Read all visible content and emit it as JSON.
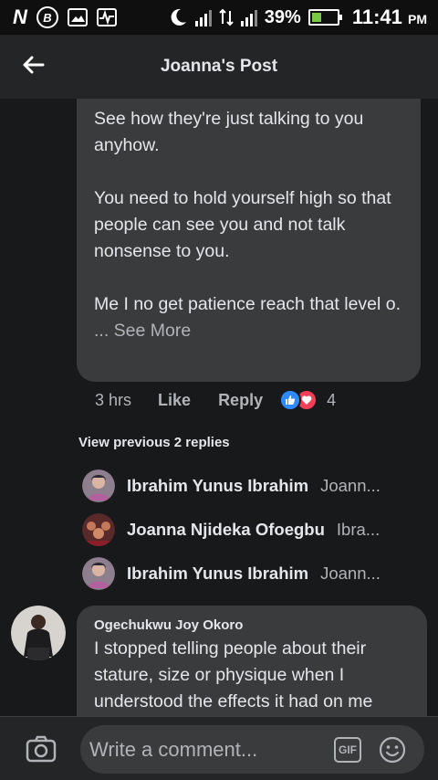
{
  "status_bar": {
    "battery_percent": "39%",
    "battery_level": 0.39,
    "time": "11:41",
    "ampm": "PM",
    "icons": [
      "n-icon",
      "b-icon",
      "gallery-icon",
      "activity-icon",
      "moon-icon",
      "signal-icon",
      "data-arrows-icon",
      "signal-icon",
      "battery-icon"
    ]
  },
  "header": {
    "title": "Joanna's Post",
    "back_icon": "arrow-left-icon"
  },
  "main_comment": {
    "text": "See how they're just talking to you anyhow.\n\nYou need to hold yourself high so that people can see you and not talk nonsense to you.\n\nMe I no get patience reach that level o.",
    "see_more": "... See More",
    "time": "3 hrs",
    "like_label": "Like",
    "reply_label": "Reply",
    "reaction_count": "4",
    "reaction_icons": [
      "like-reaction-icon",
      "love-reaction-icon"
    ]
  },
  "view_previous": "View previous 2 replies",
  "replies": [
    {
      "name": "Ibrahim Yunus Ibrahim",
      "target": "Joann..."
    },
    {
      "name": "Joanna Njideka Ofoegbu",
      "target": "Ibra..."
    },
    {
      "name": "Ibrahim Yunus Ibrahim",
      "target": "Joann..."
    }
  ],
  "second_comment": {
    "author": "Ogechukwu Joy Okoro",
    "text": "I stopped telling people about their stature, size or physique when I understood the effects it had on me"
  },
  "composer": {
    "placeholder": "Write a comment...",
    "gif_label": "GIF"
  },
  "colors": {
    "background": "#18191a",
    "bubble": "#3a3b3c",
    "header": "#242526",
    "like_blue": "#2e89ff",
    "love_red": "#f33e58"
  }
}
